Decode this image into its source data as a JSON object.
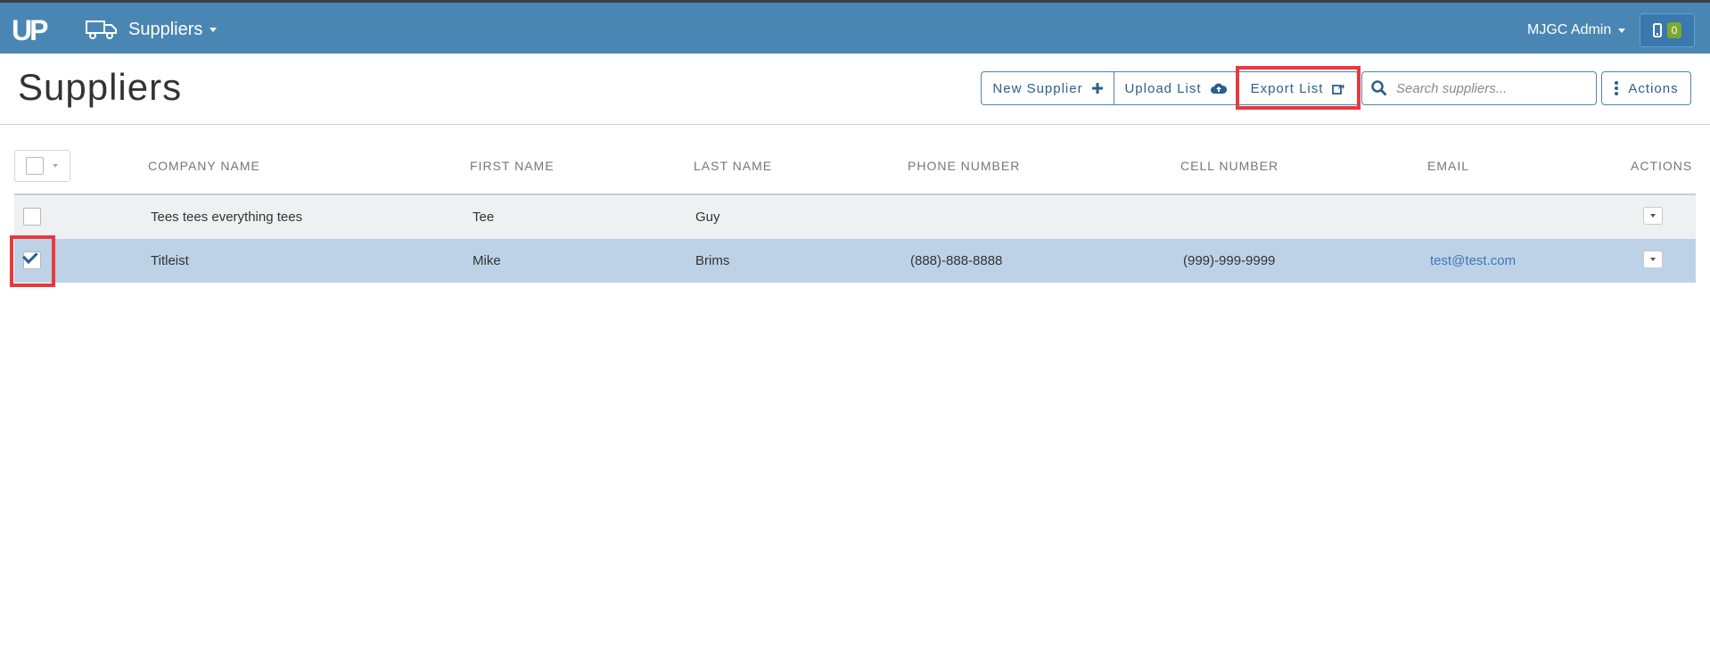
{
  "navbar": {
    "logo_text": "UP",
    "section_title": "Suppliers",
    "user_name": "MJGC Admin",
    "device_count": "0"
  },
  "page": {
    "title": "Suppliers"
  },
  "toolbar": {
    "new_label": "New Supplier",
    "upload_label": "Upload List",
    "export_label": "Export List",
    "search_placeholder": "Search suppliers...",
    "actions_label": "Actions"
  },
  "table": {
    "columns": [
      "COMPANY NAME",
      "FIRST NAME",
      "LAST NAME",
      "PHONE NUMBER",
      "CELL NUMBER",
      "EMAIL",
      "ACTIONS"
    ],
    "rows": [
      {
        "selected": false,
        "company": "Tees tees everything tees",
        "first": "Tee",
        "last": "Guy",
        "phone": "",
        "cell": "",
        "email": ""
      },
      {
        "selected": true,
        "company": "Titleist",
        "first": "Mike",
        "last": "Brims",
        "phone": "(888)-888-8888",
        "cell": "(999)-999-9999",
        "email": "test@test.com"
      }
    ]
  },
  "colors": {
    "navbar": "#4a86b4",
    "accent": "#2d5f8d",
    "selected_row": "#bdd2e7",
    "highlight": "#e8393c",
    "badge": "#7ba82f"
  }
}
